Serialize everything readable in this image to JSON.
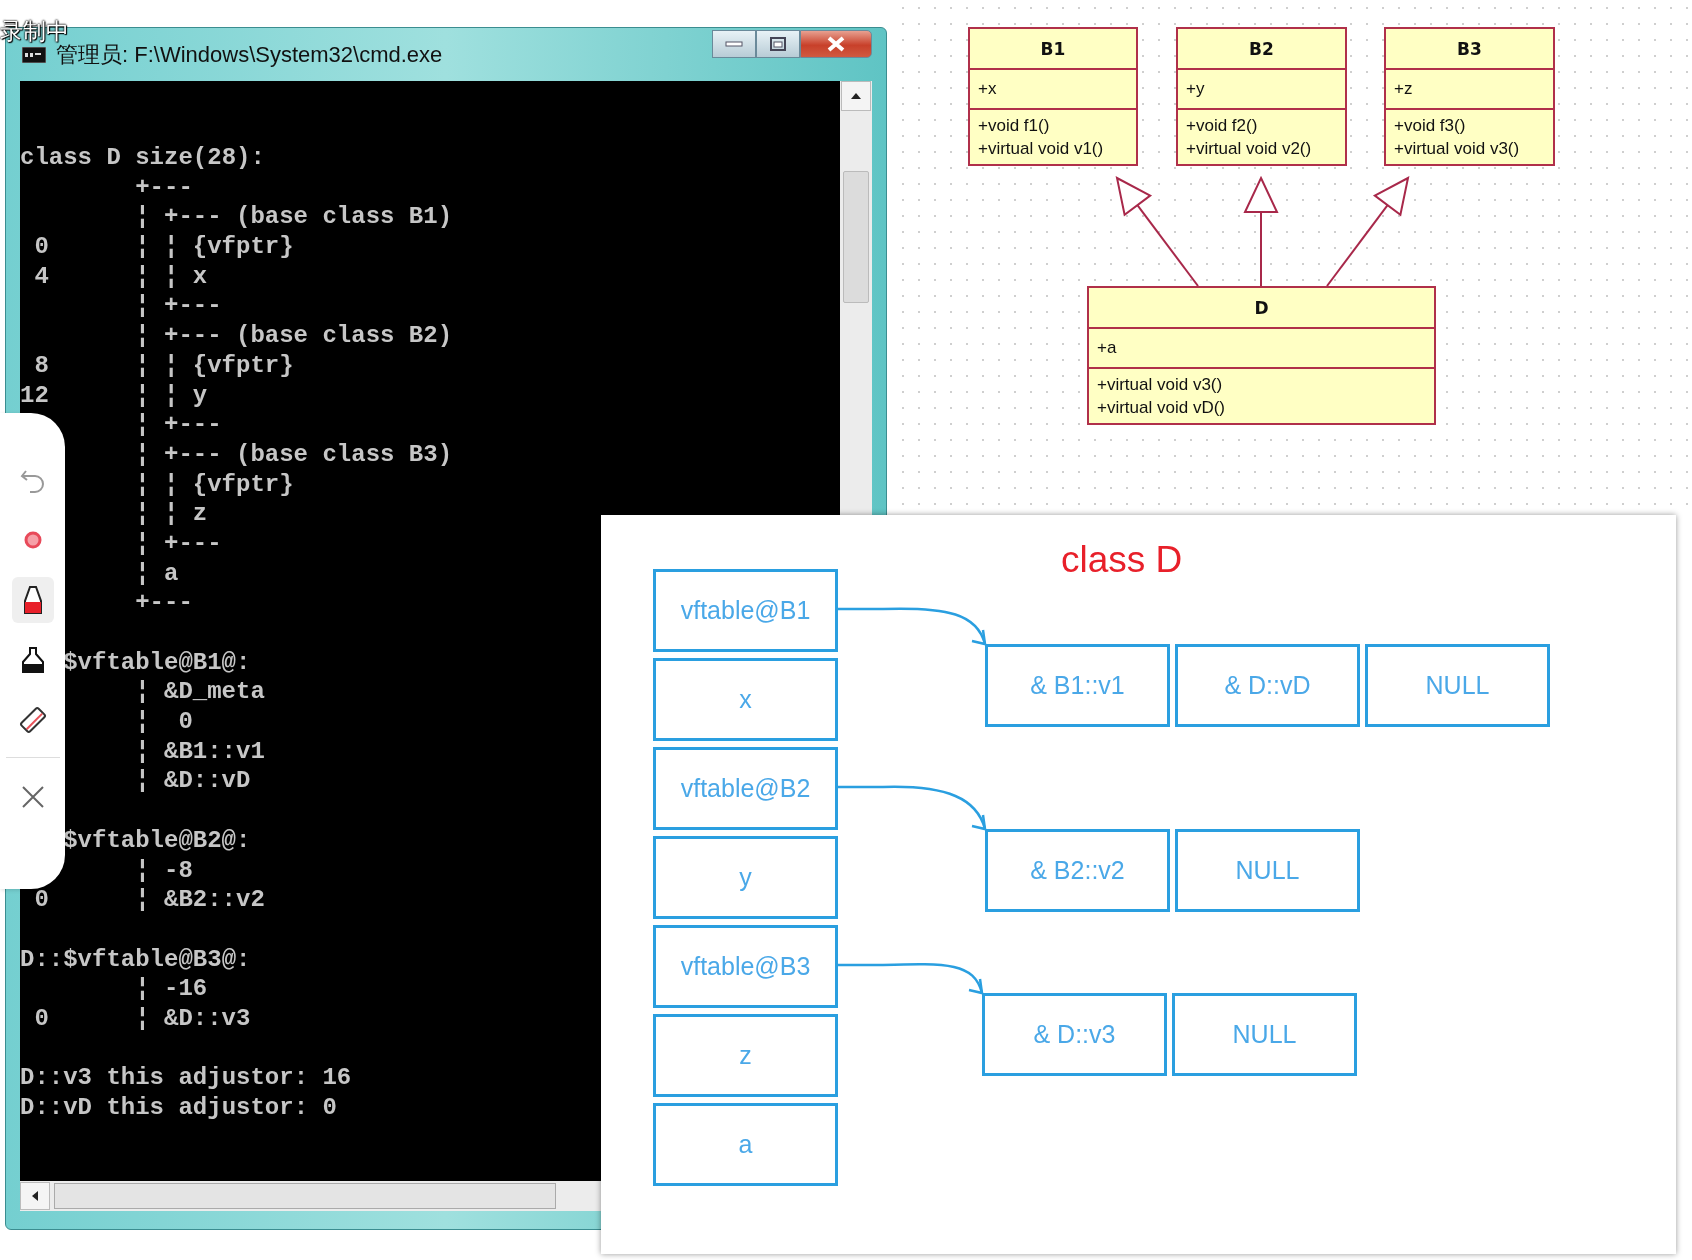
{
  "recording_indicator": "录制中",
  "console_window": {
    "title": "管理员: F:\\Windows\\System32\\cmd.exe",
    "blocks": [
      {
        "lines": [
          "class D size(28):",
          "        +---",
          "        ¦ +--- (base class B1)",
          " 0      ¦ ¦ {vfptr}",
          " 4      ¦ ¦ x",
          "        ¦ +---",
          "        ¦ +--- (base class B2)",
          " 8      ¦ ¦ {vfptr}",
          "12      ¦ ¦ y",
          "        ¦ +---",
          "        ¦ +--- (base class B3)",
          "        ¦ ¦ {vfptr}",
          "        ¦ ¦ z",
          "        ¦ +---",
          "        ¦ a",
          "        +---"
        ]
      },
      {
        "lines": [
          "   $vftable@B1@:",
          "        ¦ &D_meta",
          "        ¦  0",
          "        ¦ &B1::v1",
          "        ¦ &D::vD"
        ]
      },
      {
        "lines": [
          "   $vftable@B2@:",
          "        ¦ -8",
          " 0      ¦ &B2::v2"
        ]
      },
      {
        "lines": [
          "D::$vftable@B3@:",
          "        ¦ -16",
          " 0      ¦ &D::v3"
        ]
      },
      {
        "lines": [
          "D::v3 this adjustor: 16",
          "D::vD this adjustor: 0"
        ]
      }
    ]
  },
  "annotation_toolbar": {
    "tools": [
      {
        "kind": "undo",
        "selected": false
      },
      {
        "kind": "record",
        "selected": false
      },
      {
        "kind": "pen",
        "selected": true
      },
      {
        "kind": "highlighter",
        "selected": false
      },
      {
        "kind": "eraser",
        "selected": false
      },
      {
        "kind": "close",
        "selected": false
      }
    ]
  },
  "uml_diagram": {
    "classes": [
      {
        "name": "B1",
        "attributes": [
          "+x"
        ],
        "methods": [
          "+void f1()",
          "+virtual void v1()"
        ]
      },
      {
        "name": "B2",
        "attributes": [
          "+y"
        ],
        "methods": [
          "+void f2()",
          "+virtual void v2()"
        ]
      },
      {
        "name": "B3",
        "attributes": [
          "+z"
        ],
        "methods": [
          "+void f3()",
          "+virtual void v3()"
        ]
      },
      {
        "name": "D",
        "attributes": [
          "+a"
        ],
        "methods": [
          "+virtual void v3()",
          "+virtual void vD()"
        ]
      }
    ]
  },
  "memory_layout": {
    "title": "class D",
    "fields": [
      {
        "label": "vftable@B1",
        "kind": "vptr"
      },
      {
        "label": "x",
        "kind": "member"
      },
      {
        "label": "vftable@B2",
        "kind": "vptr"
      },
      {
        "label": "y",
        "kind": "member"
      },
      {
        "label": "vftable@B3",
        "kind": "vptr"
      },
      {
        "label": "z",
        "kind": "member"
      },
      {
        "label": "a",
        "kind": "member"
      }
    ],
    "vtables": [
      {
        "entries": [
          "& B1::v1",
          "& D::vD",
          "NULL"
        ]
      },
      {
        "entries": [
          "& B2::v2",
          "NULL"
        ]
      },
      {
        "entries": [
          "& D::v3",
          "NULL"
        ]
      }
    ]
  }
}
